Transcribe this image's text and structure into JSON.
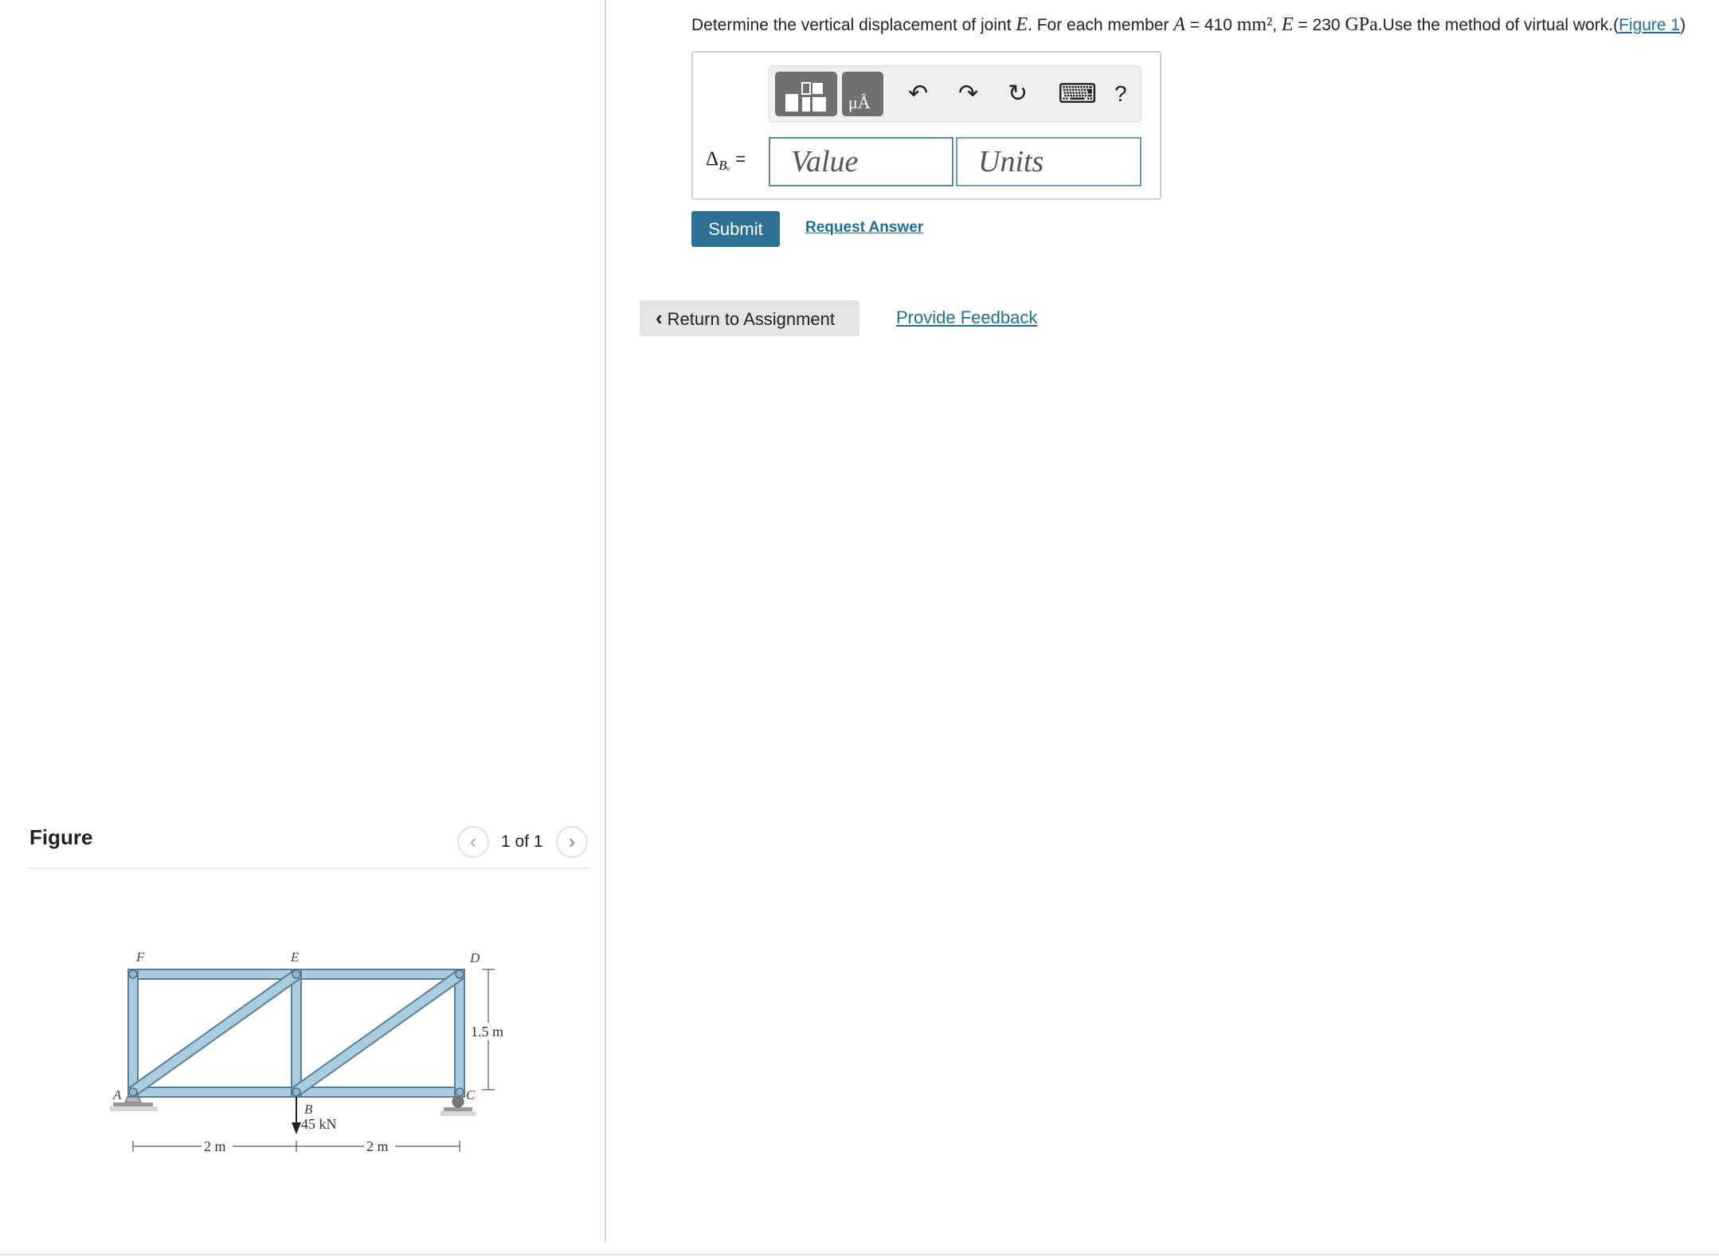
{
  "figure_panel": {
    "title": "Figure",
    "counter": "1 of 1",
    "prev_glyph": "‹",
    "next_glyph": "›",
    "truss": {
      "joint_labels": {
        "A": "A",
        "B": "B",
        "C": "C",
        "D": "D",
        "E": "E",
        "F": "F"
      },
      "load_label": "45 kN",
      "dim_left": "2 m",
      "dim_right": "2 m",
      "dim_height": "1.5 m",
      "member_color": "#a9cde0",
      "member_stroke": "#5b7f94"
    }
  },
  "question": {
    "text_1": "Determine the vertical displacement of joint ",
    "joint": "E",
    "text_2": ". For each member ",
    "area_sym": "A",
    "area_value": " = 410 ",
    "area_unit": "mm²",
    "comma": ", ",
    "modulus_sym": "E",
    "modulus_value": " = 230 ",
    "modulus_unit": "GPa",
    "text_3": ".Use the method of virtual work.(",
    "figure_link": "Figure 1",
    "text_4": ")"
  },
  "answer": {
    "delta_symbol": "Δ",
    "delta_subscript": "Bᵥ",
    "equals": "=",
    "value_placeholder": "Value",
    "units_placeholder": "Units",
    "toolbar": {
      "templates_icon": "templates-icon",
      "units_icon": "units-icon",
      "units_glyph": "μÅ",
      "undo_glyph": "↶",
      "redo_glyph": "↷",
      "reset_glyph": "↻",
      "keyboard_glyph": "⌨",
      "help_glyph": "?"
    }
  },
  "actions": {
    "submit": "Submit",
    "request_answer": "Request Answer",
    "return_chevron": "‹",
    "return": "Return to Assignment",
    "feedback": "Provide Feedback"
  },
  "colors": {
    "primary": "#2d6f95",
    "link": "#1f6f9a",
    "return_bg": "#e4e4e4"
  }
}
